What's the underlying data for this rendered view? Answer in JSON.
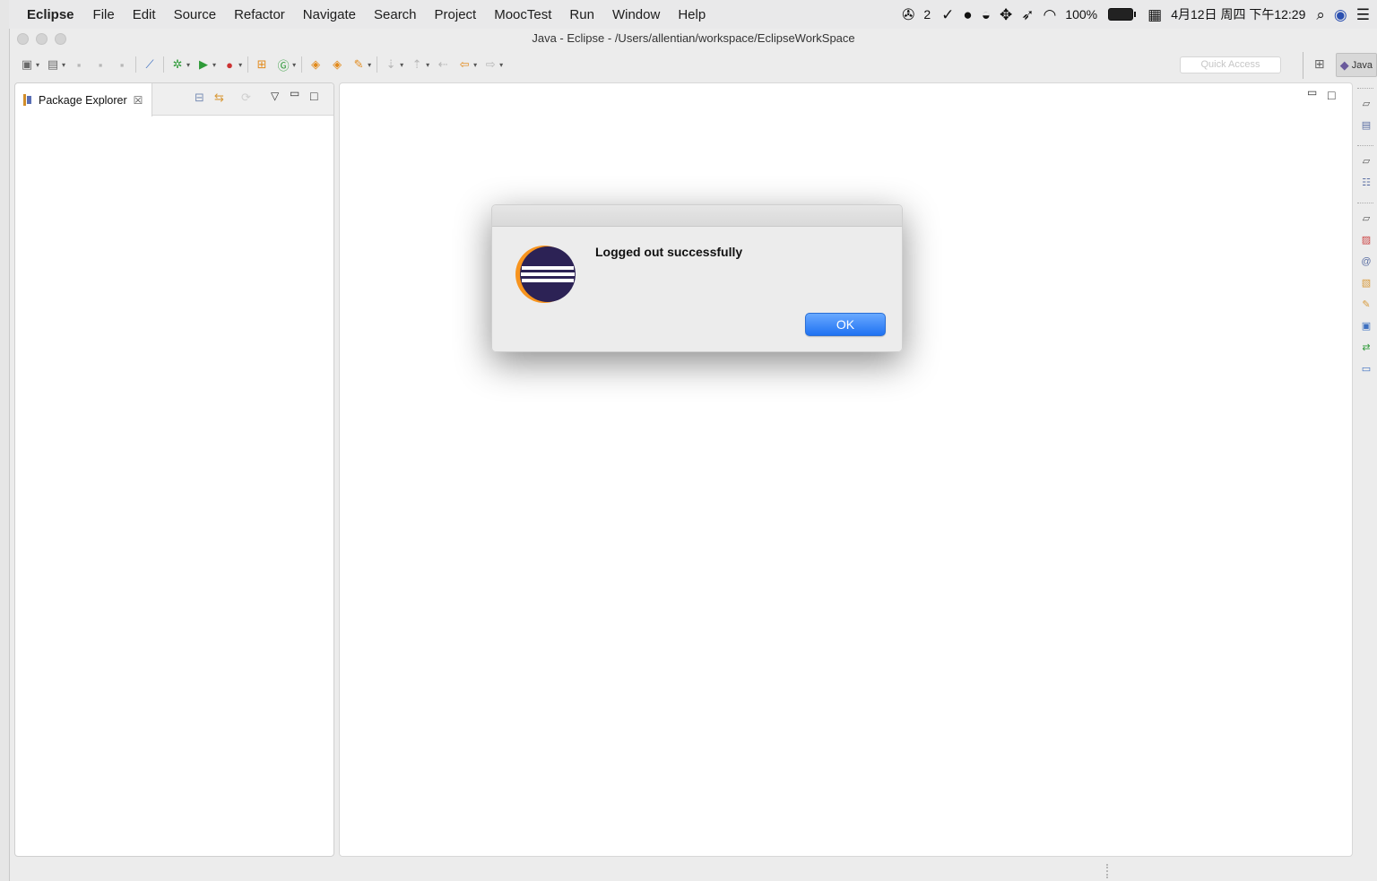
{
  "menubar": {
    "app_name": "Eclipse",
    "items": [
      "File",
      "Edit",
      "Source",
      "Refactor",
      "Navigate",
      "Search",
      "Project",
      "MoocTest",
      "Run",
      "Window",
      "Help"
    ],
    "status": {
      "wechat_count": "2",
      "battery_percent": "100%",
      "date_time": "4月12日 周四 下午12:29"
    }
  },
  "window": {
    "title": "Java - Eclipse - /Users/allentian/workspace/EclipseWorkSpace"
  },
  "toolbar": {
    "quick_access_placeholder": "Quick Access",
    "perspective_label": "Java"
  },
  "package_explorer": {
    "tab_label": "Package Explorer",
    "close_glyph": "☒"
  },
  "dialog": {
    "message": "Logged out successfully",
    "ok_label": "OK"
  },
  "colors": {
    "ok_button": "#1f72f2",
    "eclipse_logo_dark": "#2c2255",
    "eclipse_logo_orange": "#f7941e"
  }
}
